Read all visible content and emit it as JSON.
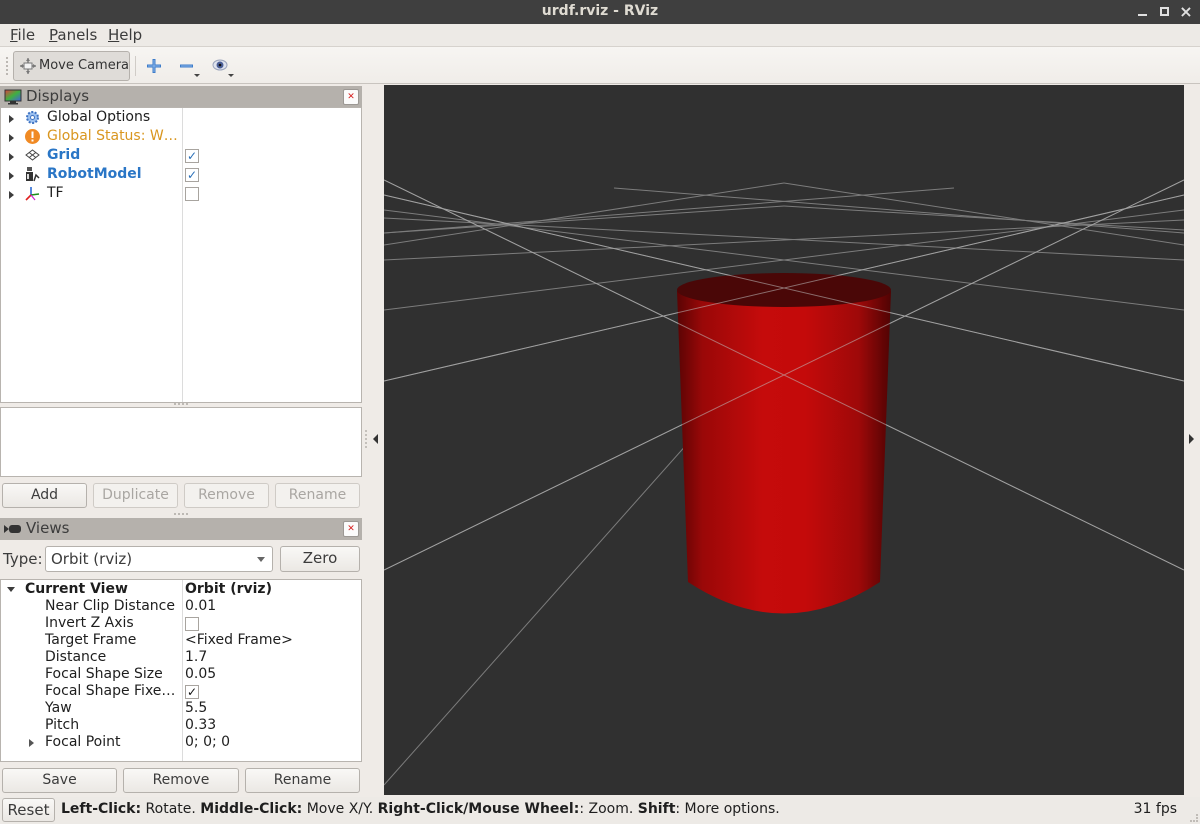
{
  "window": {
    "title": "urdf.rviz - RViz",
    "minimize": "_",
    "maximize": "□",
    "close": "×"
  },
  "menu": [
    {
      "label": "File",
      "mnemonic": "F",
      "rest": "ile"
    },
    {
      "label": "Panels",
      "mnemonic": "P",
      "rest": "anels"
    },
    {
      "label": "Help",
      "mnemonic": "H",
      "rest": "elp"
    }
  ],
  "toolbar": {
    "move_camera": "Move Camera",
    "tools": [
      {
        "icon": "plus-icon",
        "label": "Add tool"
      },
      {
        "icon": "minus-icon",
        "label": "Remove tool"
      },
      {
        "icon": "eye-icon",
        "label": "Show/hide"
      }
    ]
  },
  "displays": {
    "title": "Displays",
    "items": [
      {
        "name": "Global Options",
        "icon": "gear-icon",
        "style": "normal",
        "checkbox": null
      },
      {
        "name": "Global Status: W…",
        "icon": "warning-icon",
        "style": "warning",
        "checkbox": null
      },
      {
        "name": "Grid",
        "icon": "grid-icon",
        "style": "bold-blue",
        "checkbox": true
      },
      {
        "name": "RobotModel",
        "icon": "robot-icon",
        "style": "bold-blue",
        "checkbox": true
      },
      {
        "name": "TF",
        "icon": "axes-icon",
        "style": "normal",
        "checkbox": false
      }
    ],
    "buttons": {
      "add": "Add",
      "duplicate": "Duplicate",
      "remove": "Remove",
      "rename": "Rename"
    }
  },
  "views": {
    "title": "Views",
    "type_label": "Type:",
    "type_value": "Orbit (rviz)",
    "zero": "Zero",
    "current_view": {
      "label": "Current View",
      "value": "Orbit (rviz)"
    },
    "properties": [
      {
        "name": "Near Clip Distance",
        "value": "0.01"
      },
      {
        "name": "Invert Z Axis",
        "checkbox": false
      },
      {
        "name": "Target Frame",
        "value": "<Fixed Frame>"
      },
      {
        "name": "Distance",
        "value": "1.7"
      },
      {
        "name": "Focal Shape Size",
        "value": "0.05"
      },
      {
        "name": "Focal Shape Fixe…",
        "checkbox": true
      },
      {
        "name": "Yaw",
        "value": "5.5"
      },
      {
        "name": "Pitch",
        "value": "0.33"
      },
      {
        "name": "Focal Point",
        "value": "0; 0; 0",
        "expandable": true
      }
    ],
    "buttons": {
      "save": "Save",
      "remove": "Remove",
      "rename": "Rename"
    }
  },
  "status": {
    "reset": "Reset",
    "hints": [
      {
        "key": "Left-Click:",
        "text": " Rotate. "
      },
      {
        "key": "Middle-Click:",
        "text": " Move X/Y. "
      },
      {
        "key": "Right-Click/Mouse Wheel:",
        "text": ": Zoom. "
      },
      {
        "key": "Shift",
        "text": ": More options."
      }
    ],
    "fps": "31 fps"
  },
  "scene": {
    "background": "#303030",
    "object": "cylinder",
    "object_color": "#c40a0a",
    "grid_color": "#8a8a8a"
  }
}
